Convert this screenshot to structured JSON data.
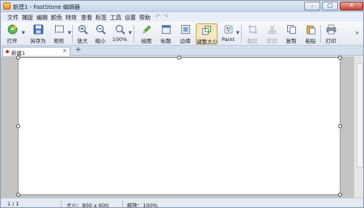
{
  "window": {
    "title": "新建1 - FastStone 编辑器"
  },
  "menu": [
    "文件",
    "捕捉",
    "编辑",
    "颜色",
    "特效",
    "查看",
    "标签",
    "工具",
    "设置",
    "帮助"
  ],
  "toolbar": {
    "open": "打开",
    "save_as": "另存为",
    "rectangle": "矩形",
    "zoom_in": "放大",
    "zoom_out": "缩小",
    "zoom_level": "100%",
    "draw": "绘图",
    "caption": "标题",
    "edge": "边缘",
    "resize": "调整大小",
    "paint": "Paint",
    "crop": "裁剪",
    "cut": "剪切",
    "copy": "复制",
    "paste": "粘贴",
    "print": "打印"
  },
  "tabs": [
    {
      "label": "新建1"
    }
  ],
  "status": {
    "page": "1 / 1",
    "size": "大小：800 x 600",
    "zoom": "缩放：100%"
  },
  "colors": {
    "chrome": "#d9e3ee",
    "workspace": "#c4c4c4",
    "close_button": "#c7453a",
    "pressed": "#f5e6c3"
  },
  "icons": [
    "app-icon",
    "undo-icon",
    "redo-icon",
    "open-icon",
    "save-icon",
    "rectangle-select-icon",
    "zoom-in-icon",
    "zoom-out-icon",
    "draw-icon",
    "caption-icon",
    "edge-icon",
    "resize-icon",
    "crop-icon",
    "cut-icon",
    "copy-icon",
    "paste-icon",
    "print-icon",
    "chevron-more-icon",
    "tab-close-icon",
    "add-tab-icon"
  ]
}
